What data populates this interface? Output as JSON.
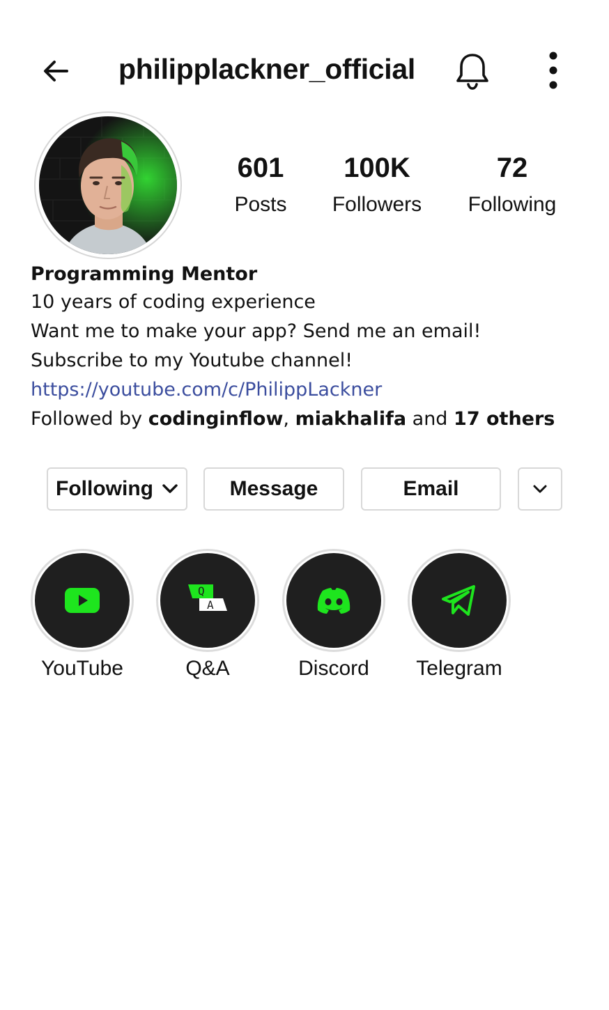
{
  "header": {
    "username": "philipplackner_official",
    "icons": [
      "back-arrow-icon",
      "bell-icon",
      "more-vertical-icon"
    ]
  },
  "stats": {
    "posts": {
      "value": "601",
      "label": "Posts"
    },
    "followers": {
      "value": "100K",
      "label": "Followers"
    },
    "following": {
      "value": "72",
      "label": "Following"
    }
  },
  "bio": {
    "name": "Programming Mentor",
    "lines": [
      "10 years of coding experience",
      "Want me to make your app? Send me an email!",
      "Subscribe to my Youtube channel!"
    ],
    "link": "https://youtube.com/c/PhilippLackner",
    "followed_by": {
      "prefix": "Followed by ",
      "user1": "codinginflow",
      "separator": ", ",
      "user2": "miakhalifa",
      "and": " and ",
      "others": "17 others"
    }
  },
  "actions": {
    "following_label": "Following",
    "message_label": "Message",
    "email_label": "Email"
  },
  "highlights": [
    {
      "label": "YouTube",
      "icon": "youtube-icon"
    },
    {
      "label": "Q&A",
      "icon": "qa-icon"
    },
    {
      "label": "Discord",
      "icon": "discord-icon"
    },
    {
      "label": "Telegram",
      "icon": "telegram-icon"
    }
  ],
  "colors": {
    "accent_green": "#1ee51e",
    "link": "#3b4d9e",
    "highlight_bg": "#1f1f1f",
    "border": "#d8d8d8"
  }
}
